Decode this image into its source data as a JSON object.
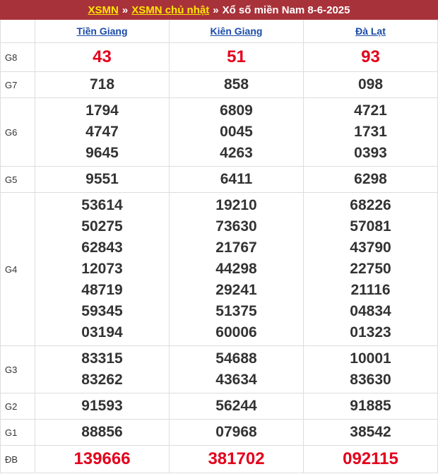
{
  "breadcrumb": {
    "link1": "XSMN",
    "link2": "XSMN chủ nhật",
    "separator": "»",
    "title": "Xổ số miền Nam 8-6-2025"
  },
  "provinces": [
    "Tiền Giang",
    "Kiên Giang",
    "Đà Lạt"
  ],
  "prizes": {
    "g8": {
      "label": "G8",
      "values": [
        "43",
        "51",
        "93"
      ]
    },
    "g7": {
      "label": "G7",
      "values": [
        "718",
        "858",
        "098"
      ]
    },
    "g6": {
      "label": "G6",
      "values": [
        [
          "1794",
          "4747",
          "9645"
        ],
        [
          "6809",
          "0045",
          "4263"
        ],
        [
          "4721",
          "1731",
          "0393"
        ]
      ]
    },
    "g5": {
      "label": "G5",
      "values": [
        "9551",
        "6411",
        "6298"
      ]
    },
    "g4": {
      "label": "G4",
      "values": [
        [
          "53614",
          "50275",
          "62843",
          "12073",
          "48719",
          "59345",
          "03194"
        ],
        [
          "19210",
          "73630",
          "21767",
          "44298",
          "29241",
          "51375",
          "60006"
        ],
        [
          "68226",
          "57081",
          "43790",
          "22750",
          "21116",
          "04834",
          "01323"
        ]
      ]
    },
    "g3": {
      "label": "G3",
      "values": [
        [
          "83315",
          "83262"
        ],
        [
          "54688",
          "43634"
        ],
        [
          "10001",
          "83630"
        ]
      ]
    },
    "g2": {
      "label": "G2",
      "values": [
        "91593",
        "56244",
        "91885"
      ]
    },
    "g1": {
      "label": "G1",
      "values": [
        "88856",
        "07968",
        "38542"
      ]
    },
    "db": {
      "label": "ĐB",
      "values": [
        "139666",
        "381702",
        "092115"
      ]
    }
  },
  "colors": {
    "header_bg": "#a8323a",
    "header_link": "#ffe600",
    "province_link": "#1a4ba8",
    "highlight": "#e3001b",
    "text": "#333333"
  }
}
